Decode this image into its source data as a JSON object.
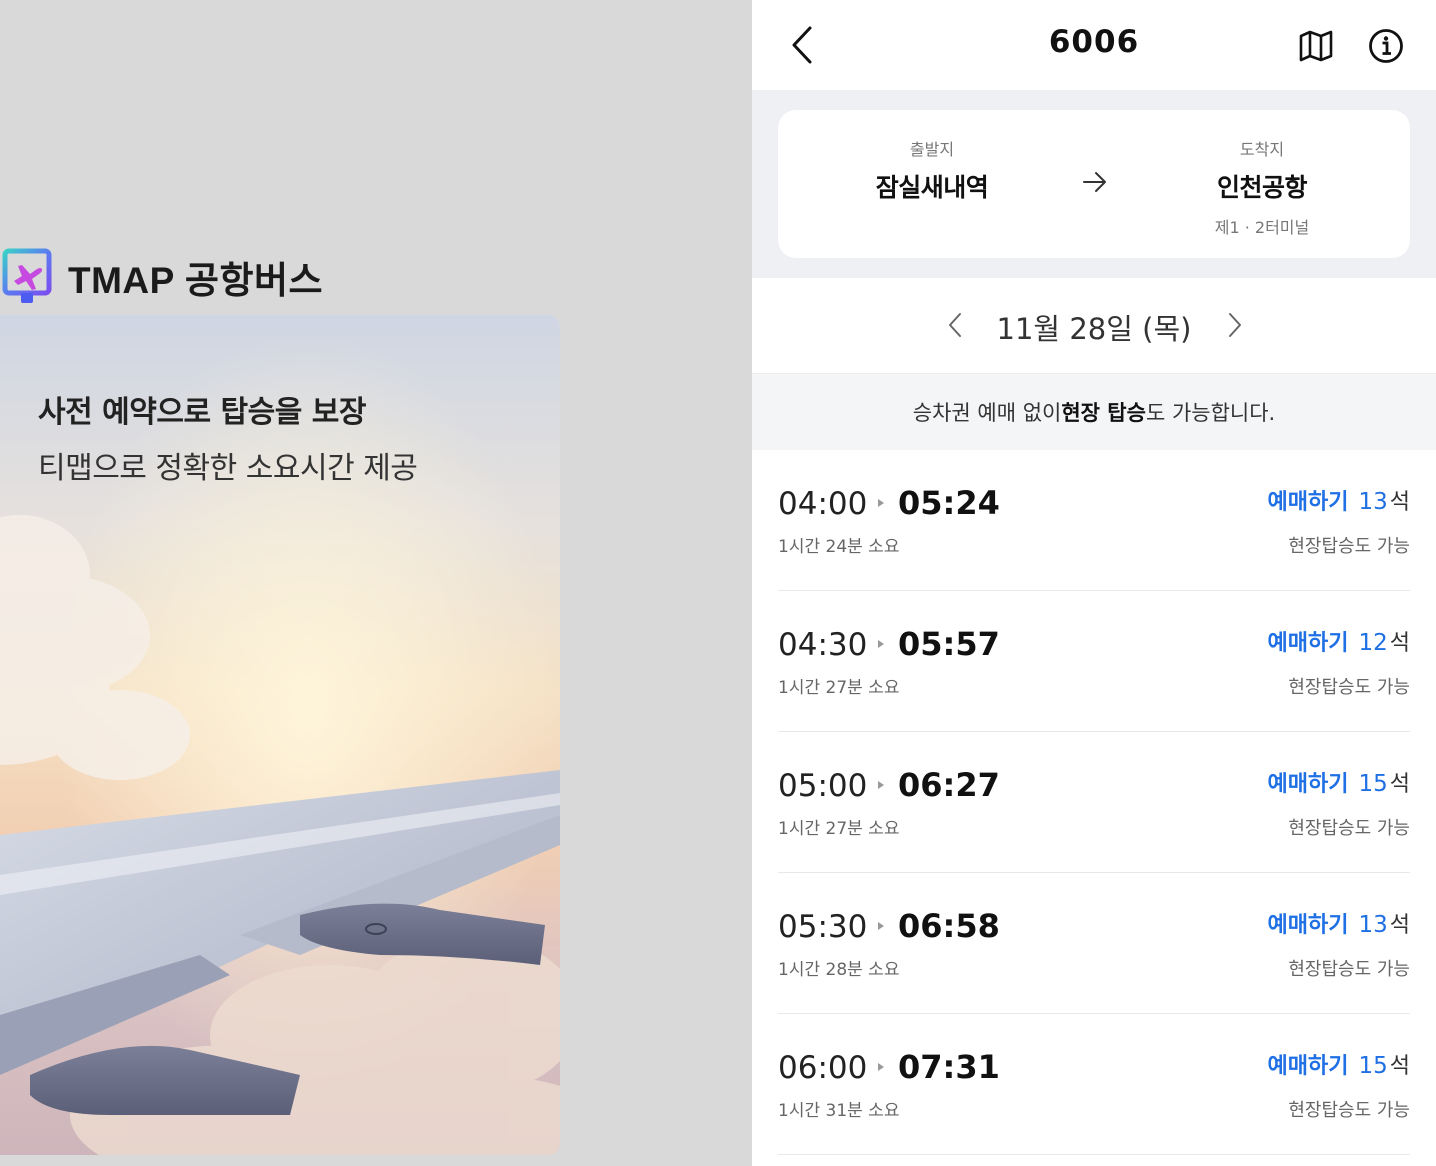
{
  "brand": {
    "name": "TMAP 공항버스",
    "icon": "airplane-pin-logo"
  },
  "promo": {
    "headline": "사전 예약으로 탑승을 보장",
    "subline": "티맵으로 정확한 소요시간 제공"
  },
  "header": {
    "title": "6006",
    "icons": {
      "back": "chevron-left-icon",
      "map": "map-icon",
      "info": "info-icon"
    }
  },
  "route": {
    "from_label": "출발지",
    "from_name": "잠실새내역",
    "to_label": "도착지",
    "to_name": "인천공항",
    "to_note": "제1 · 2터미널"
  },
  "date": {
    "text": "11월 28일 (목)"
  },
  "notice": {
    "pre": "승차권 예매 없이 ",
    "bold": "현장 탑승",
    "post": "도 가능합니다."
  },
  "trips": [
    {
      "depart": "04:00",
      "arrive": "05:24",
      "duration": "1시간 24분 소요",
      "book_label": "예매하기",
      "seats": "13",
      "seat_unit": "석",
      "onsite": "현장탑승도 가능"
    },
    {
      "depart": "04:30",
      "arrive": "05:57",
      "duration": "1시간 27분 소요",
      "book_label": "예매하기",
      "seats": "12",
      "seat_unit": "석",
      "onsite": "현장탑승도 가능"
    },
    {
      "depart": "05:00",
      "arrive": "06:27",
      "duration": "1시간 27분 소요",
      "book_label": "예매하기",
      "seats": "15",
      "seat_unit": "석",
      "onsite": "현장탑승도 가능"
    },
    {
      "depart": "05:30",
      "arrive": "06:58",
      "duration": "1시간 28분 소요",
      "book_label": "예매하기",
      "seats": "13",
      "seat_unit": "석",
      "onsite": "현장탑승도 가능"
    },
    {
      "depart": "06:00",
      "arrive": "07:31",
      "duration": "1시간 31분 소요",
      "book_label": "예매하기",
      "seats": "15",
      "seat_unit": "석",
      "onsite": "현장탑승도 가능"
    }
  ],
  "colors": {
    "accent": "#1f6fe5",
    "panel_bg": "#eff0f3",
    "page_bg": "#d9d9d9"
  }
}
